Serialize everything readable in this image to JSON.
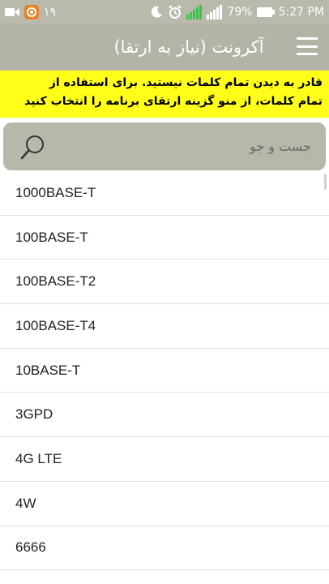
{
  "status_bar": {
    "notification_count": "۱۹",
    "battery_percent": "79%",
    "time": "5:27 PM",
    "icons": [
      "camera-icon",
      "app-notification-icon",
      "moon-icon",
      "alarm-icon",
      "sim-signal-icon",
      "sim-signal-icon",
      "battery-icon"
    ]
  },
  "toolbar": {
    "title": "آکرونت (نیاز به ارتقا)",
    "menu_icon": "hamburger-menu-icon"
  },
  "banner": {
    "line1": "قادر به دیدن تمام کلمات نیستید. برای استفاده از",
    "line2": "تمام کلمات، از منو گزینه ارتقای برنامه را انتخاب کنید"
  },
  "search": {
    "placeholder": "جست و جو",
    "icon": "search-icon"
  },
  "list": {
    "items": [
      "1000BASE-T",
      "100BASE-T",
      "100BASE-T2",
      "100BASE-T4",
      "10BASE-T",
      "3GPD",
      "4G LTE",
      "4W",
      "6666"
    ]
  },
  "colors": {
    "toolbar": "#b3b3a6",
    "banner": "#ffff1a",
    "search_bar": "#b7b7aa"
  }
}
